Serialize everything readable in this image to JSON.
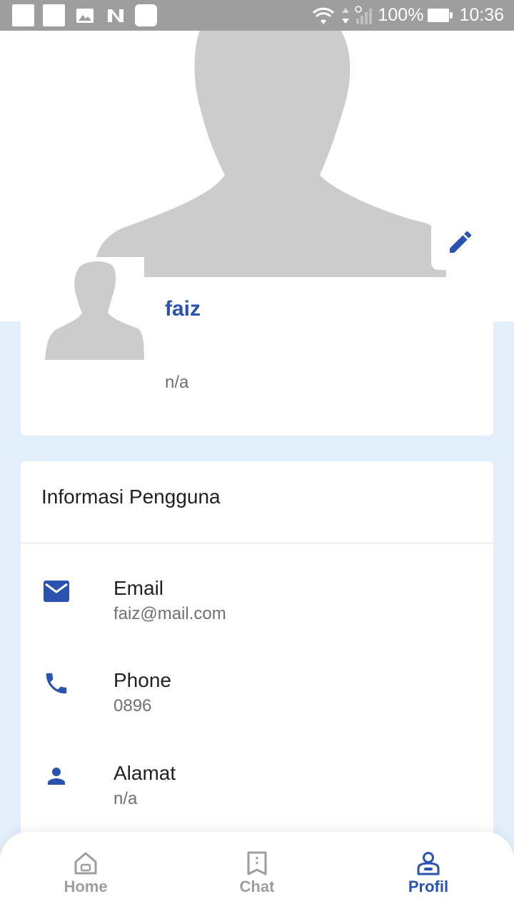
{
  "status_bar": {
    "battery": "100%",
    "time": "10:36"
  },
  "profile": {
    "name": "faiz",
    "subtitle": "n/a"
  },
  "info": {
    "title": "Informasi Pengguna",
    "rows": [
      {
        "label": "Email",
        "value": "faiz@mail.com",
        "icon": "email-icon"
      },
      {
        "label": "Phone",
        "value": "0896",
        "icon": "phone-icon"
      },
      {
        "label": "Alamat",
        "value": "n/a",
        "icon": "person-icon"
      }
    ]
  },
  "nav": [
    {
      "label": "Home",
      "icon": "home-icon",
      "active": false
    },
    {
      "label": "Chat",
      "icon": "chat-icon",
      "active": false
    },
    {
      "label": "Profil",
      "icon": "profile-icon",
      "active": true
    }
  ],
  "colors": {
    "accent": "#2a52b0",
    "page_bg": "#e3f0fb",
    "inactive": "#9e9e9e"
  }
}
